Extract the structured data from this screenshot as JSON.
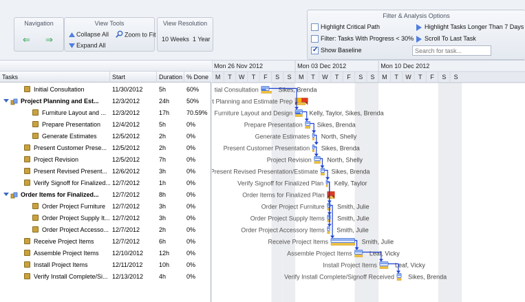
{
  "toolbar": {
    "navigation": {
      "title": "Navigation"
    },
    "view_tools": {
      "title": "View Tools",
      "collapse_all": "Collapse All",
      "zoom_to_fit": "Zoom to Fit",
      "expand_all": "Expand All"
    },
    "view_resolution": {
      "title": "View Resolution",
      "option_weeks": "10 Weeks",
      "option_year": "1 Year"
    },
    "filter": {
      "title": "Filter & Analysis Options",
      "highlight_critical": "Highlight Critical Path",
      "highlight_critical_checked": false,
      "filter_progress": "Filter: Tasks With Progress < 30%",
      "filter_progress_checked": false,
      "show_baseline": "Show Baseline",
      "show_baseline_checked": true,
      "highlight_longer": "Highlight Tasks Longer Than 7 Days",
      "scroll_last": "Scroll To Last Task",
      "search_placeholder": "Search for task..."
    }
  },
  "grid": {
    "columns": {
      "tasks": "Tasks",
      "start": "Start",
      "duration": "Duration",
      "done": "% Done"
    },
    "rows": [
      {
        "name": "Initial Consultation",
        "start": "11/30/2012",
        "duration": "5h",
        "done": "60%",
        "type": "task"
      },
      {
        "name": "Project Planning and Est...",
        "start": "12/3/2012",
        "duration": "24h",
        "done": "50%",
        "type": "parent"
      },
      {
        "name": "Furniture Layout and ...",
        "start": "12/3/2012",
        "duration": "17h",
        "done": "70.59%",
        "type": "child"
      },
      {
        "name": "Prepare Presentation",
        "start": "12/4/2012",
        "duration": "5h",
        "done": "0%",
        "type": "child"
      },
      {
        "name": "Generate Estimates",
        "start": "12/5/2012",
        "duration": "2h",
        "done": "0%",
        "type": "child"
      },
      {
        "name": "Present Customer Prese...",
        "start": "12/5/2012",
        "duration": "2h",
        "done": "0%",
        "type": "task"
      },
      {
        "name": "Project Revision",
        "start": "12/5/2012",
        "duration": "7h",
        "done": "0%",
        "type": "task"
      },
      {
        "name": "Present Revised Present...",
        "start": "12/6/2012",
        "duration": "3h",
        "done": "0%",
        "type": "task"
      },
      {
        "name": "Verify Signoff for Finalized...",
        "start": "12/7/2012",
        "duration": "1h",
        "done": "0%",
        "type": "task"
      },
      {
        "name": "Order Items for Finalized...",
        "start": "12/7/2012",
        "duration": "8h",
        "done": "0%",
        "type": "parent"
      },
      {
        "name": "Order Project Furniture",
        "start": "12/7/2012",
        "duration": "3h",
        "done": "0%",
        "type": "child"
      },
      {
        "name": "Order Project Supply It...",
        "start": "12/7/2012",
        "duration": "3h",
        "done": "0%",
        "type": "child"
      },
      {
        "name": "Order Project Accesso...",
        "start": "12/7/2012",
        "duration": "2h",
        "done": "0%",
        "type": "child"
      },
      {
        "name": "Receive Project Items",
        "start": "12/7/2012",
        "duration": "6h",
        "done": "0%",
        "type": "task"
      },
      {
        "name": "Assemble Project Items",
        "start": "12/10/2012",
        "duration": "12h",
        "done": "0%",
        "type": "task"
      },
      {
        "name": "Install Project Items",
        "start": "12/11/2012",
        "duration": "10h",
        "done": "0%",
        "type": "task"
      },
      {
        "name": "Verify Install Complete/Si...",
        "start": "12/13/2012",
        "duration": "4h",
        "done": "0%",
        "type": "task"
      }
    ]
  },
  "timeline": {
    "weeks": [
      "Mon 26 Nov 2012",
      "Mon 03 Dec 2012",
      "Mon 10 Dec 2012"
    ],
    "days": [
      "M",
      "T",
      "W",
      "T",
      "F",
      "S",
      "S",
      "M",
      "T",
      "W",
      "T",
      "F",
      "S",
      "S",
      "M",
      "T",
      "W",
      "T",
      "F",
      "S",
      "S"
    ],
    "bars": [
      {
        "label": "tial Consultation",
        "resource": "Sikes, Brenda",
        "start_day": 4.15,
        "end_day": 4.8,
        "baseline_start": 4.15,
        "baseline_end": 5.0,
        "progress": 0.6,
        "type": "task"
      },
      {
        "label": "Project Planning and Estimate Prep",
        "resource": "",
        "start_day": 7.0,
        "end_day": 8.05,
        "baseline_start": 7.0,
        "baseline_end": 7.85,
        "progress": 0.5,
        "type": "parent"
      },
      {
        "label": "Furniture Layout and Design",
        "resource": "Kelly, Taylor, Sikes, Brenda",
        "start_day": 7.0,
        "end_day": 7.6,
        "baseline_start": 7.0,
        "baseline_end": 7.6,
        "progress": 0.7059,
        "type": "task"
      },
      {
        "label": "Prepare Presentation",
        "resource": "Sikes, Brenda",
        "start_day": 7.85,
        "end_day": 8.25,
        "baseline_start": 7.85,
        "baseline_end": 8.25,
        "progress": 0,
        "type": "task"
      },
      {
        "label": "Generate Estimates",
        "resource": "North, Shelly",
        "start_day": 8.45,
        "end_day": 8.6,
        "baseline_start": 8.45,
        "baseline_end": 8.6,
        "progress": 0,
        "type": "task"
      },
      {
        "label": "Present Customer Presentation",
        "resource": "Sikes, Brenda",
        "start_day": 8.45,
        "end_day": 8.6,
        "baseline_start": 8.45,
        "baseline_end": 8.6,
        "progress": 0,
        "type": "task"
      },
      {
        "label": "Project Revision",
        "resource": "North, Shelly",
        "start_day": 8.6,
        "end_day": 9.1,
        "baseline_start": 8.6,
        "baseline_end": 9.1,
        "progress": 0,
        "type": "task"
      },
      {
        "label": "Present Revised Presentation/Estimate",
        "resource": "Sikes, Brenda",
        "start_day": 9.15,
        "end_day": 9.45,
        "baseline_start": 9.15,
        "baseline_end": 9.45,
        "progress": 0,
        "type": "task"
      },
      {
        "label": "Verify Signoff for Finalized Plan",
        "resource": "Kelly, Taylor",
        "start_day": 9.6,
        "end_day": 9.7,
        "baseline_start": 9.6,
        "baseline_end": 9.7,
        "progress": 0,
        "type": "task"
      },
      {
        "label": "Order Items for Finalized Plan",
        "resource": "",
        "start_day": 9.7,
        "end_day": 10.3,
        "baseline_start": 9.7,
        "baseline_end": 10.3,
        "progress": 0,
        "type": "parent"
      },
      {
        "label": "Order Project Furniture",
        "resource": "Smith, Julie",
        "start_day": 9.7,
        "end_day": 9.95,
        "baseline_start": 9.7,
        "baseline_end": 9.95,
        "progress": 0,
        "type": "task"
      },
      {
        "label": "Order Project Supply Items",
        "resource": "Smith, Julie",
        "start_day": 9.7,
        "end_day": 9.95,
        "baseline_start": 9.7,
        "baseline_end": 9.95,
        "progress": 0,
        "type": "task"
      },
      {
        "label": "Order Project Accessory Items",
        "resource": "Smith, Julie",
        "start_day": 9.7,
        "end_day": 9.9,
        "baseline_start": 9.7,
        "baseline_end": 9.9,
        "progress": 0,
        "type": "task"
      },
      {
        "label": "Receive Project Items",
        "resource": "Smith, Julie",
        "start_day": 10.0,
        "end_day": 12.0,
        "baseline_start": 10.0,
        "baseline_end": 12.0,
        "progress": 0,
        "type": "task"
      },
      {
        "label": "Assemble Project Items",
        "resource": "Leaf, Vicky",
        "start_day": 12.0,
        "end_day": 12.65,
        "baseline_start": 12.0,
        "baseline_end": 12.65,
        "progress": 0,
        "type": "task"
      },
      {
        "label": "Install Project Items",
        "resource": "Leaf, Vicky",
        "start_day": 14.1,
        "end_day": 14.8,
        "baseline_start": 14.1,
        "baseline_end": 14.8,
        "progress": 0,
        "type": "task"
      },
      {
        "label": "Verify Install Complete/Signoff Received",
        "resource": "Sikes, Brenda",
        "start_day": 15.55,
        "end_day": 15.9,
        "baseline_start": 15.55,
        "baseline_end": 15.9,
        "progress": 0,
        "type": "task"
      }
    ]
  },
  "colors": {
    "accent": "#3a66c2",
    "task_bar": "#2f62d8",
    "baseline": "#f0c03c",
    "progress": "#f7b500",
    "weekend": "#ecedf0",
    "dependency": "#1d3fcf"
  }
}
